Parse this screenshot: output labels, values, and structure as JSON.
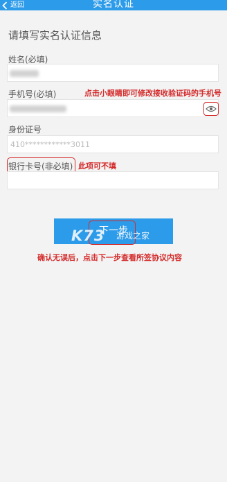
{
  "header": {
    "back_label": "返回",
    "title": "实名认证"
  },
  "form": {
    "heading": "请填写实名认证信息",
    "name": {
      "label": "姓名(必填)",
      "value": ""
    },
    "phone": {
      "label": "手机号(必填)",
      "value": ""
    },
    "id_card": {
      "label": "身份证号",
      "value": "410************3011"
    },
    "bank_card": {
      "label": "银行卡号(非必填)",
      "value": ""
    },
    "next_label": "下一步"
  },
  "annotations": {
    "eye_hint": "点击小眼睛即可修改接收验证码的手机号",
    "optional_hint": "此项可不填",
    "confirm_hint": "确认无误后，点击下一步查看所签协议内容"
  },
  "watermark": {
    "logo": "K73",
    "text": "游戏之家"
  },
  "colors": {
    "header": "#2c9bea",
    "annotation": "#d42a2a",
    "background": "#f3f3f3"
  }
}
